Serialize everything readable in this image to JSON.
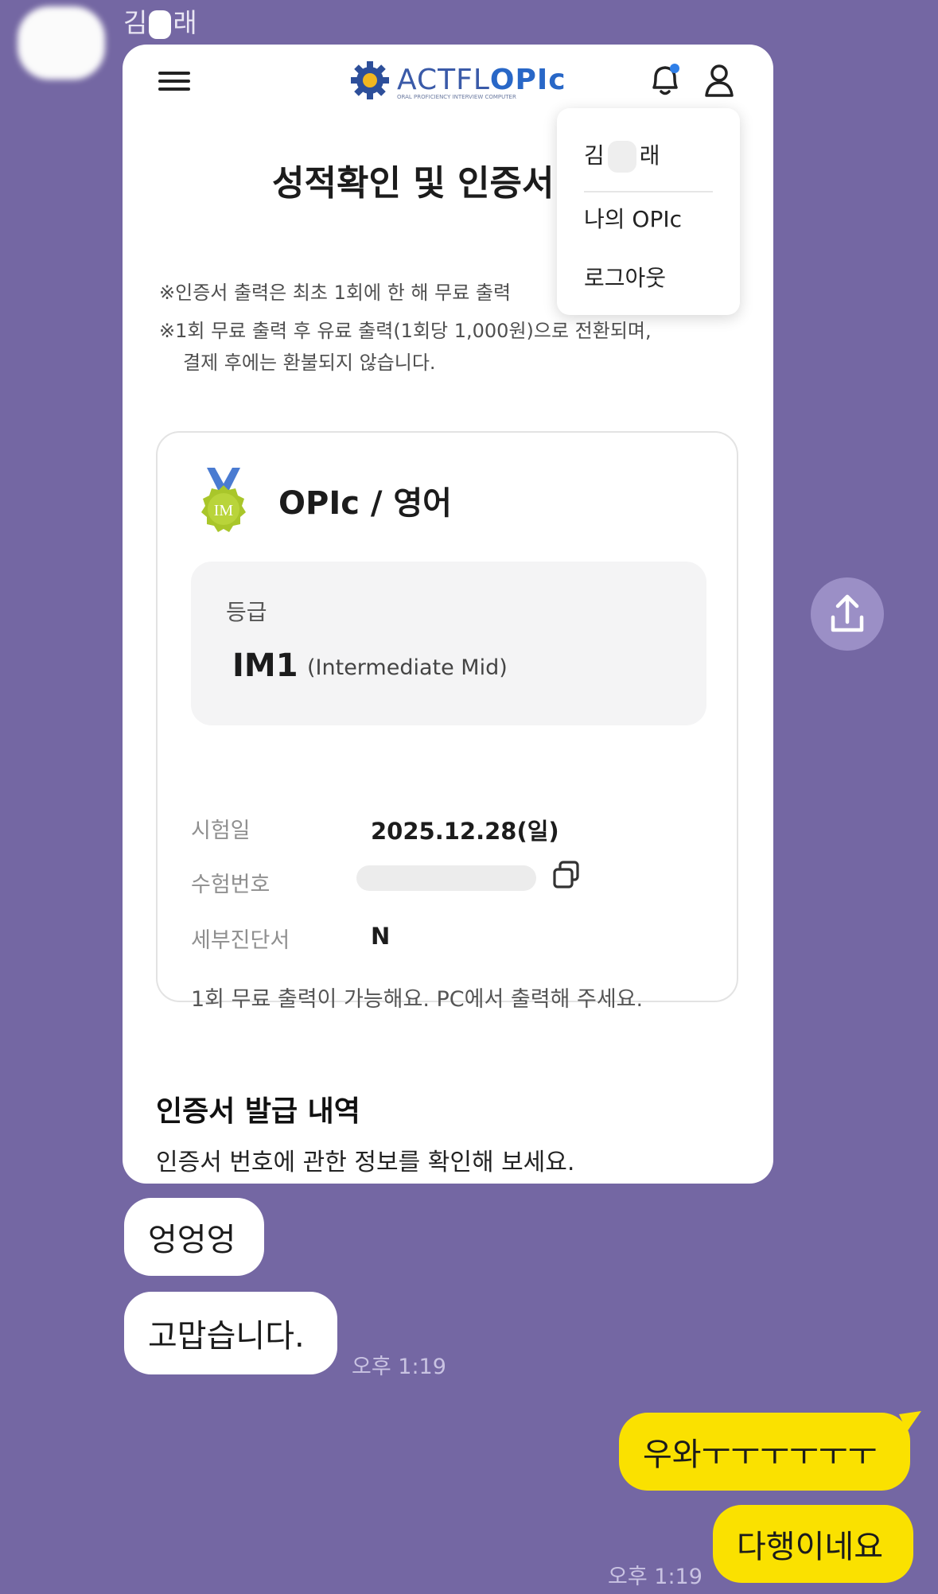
{
  "chat": {
    "sender_prefix": "김",
    "sender_suffix": "래",
    "messages": {
      "m1": "엉엉엉",
      "m2": "고맙습니다.",
      "m2_time": "오후 1:19",
      "m3": "우와ㅜㅜㅜㅜㅜㅜ",
      "m4": "다행이네요",
      "m4_time": "오후 1:19"
    },
    "colors": {
      "background": "#7467a3",
      "my_bubble": "#fae100",
      "their_bubble": "#ffffff"
    }
  },
  "screenshot": {
    "logo": {
      "brand_a": "ACTFL",
      "brand_b": "OPIc",
      "tagline": "ORAL PROFICIENCY INTERVIEW COMPUTER"
    },
    "page_title": "성적확인 및 인증서",
    "notice1": "※인증서 출력은 최초 1회에 한 해 무료 출력",
    "notice2": "※1회 무료 출력 후 유료 출력(1회당 1,000원)으로 전환되며,",
    "notice3": "결제 후에는 환불되지 않습니다.",
    "menu": {
      "name_prefix": "김",
      "name_suffix": "래",
      "item1": "나의 OPIc",
      "item2": "로그아웃"
    },
    "card": {
      "medal_text": "IM",
      "title": "OPIc / 영어",
      "grade_label": "등급",
      "grade_value": "IM1",
      "grade_desc": "(Intermediate Mid)",
      "row1_label": "시험일",
      "row1_value": "2025.12.28(일)",
      "row2_label": "수험번호",
      "row3_label": "세부진단서",
      "row3_value": "N",
      "free_note": "1회 무료 출력이 가능해요. PC에서 출력해 주세요."
    },
    "section_title": "인증서 발급 내역",
    "section_sub": "인증서 번호에 관한 정보를 확인해 보세요.",
    "colors": {
      "brand_blue": "#2867c7",
      "medal_green": "#a9c62a"
    }
  }
}
